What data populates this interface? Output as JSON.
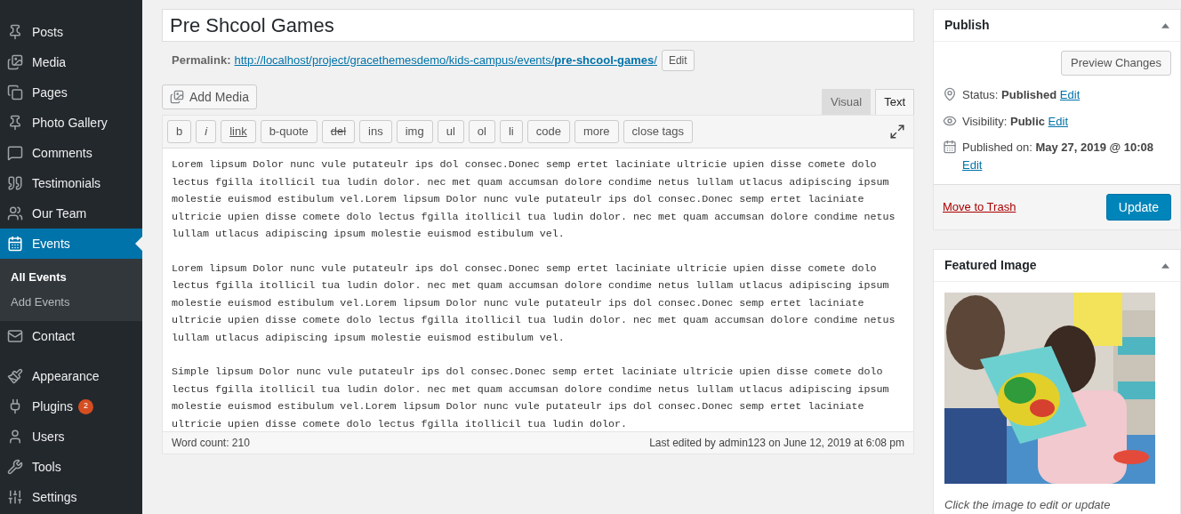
{
  "sidebar": {
    "sections": [
      {
        "items": [
          {
            "label": "Posts",
            "kind": "pin",
            "selected": false
          },
          {
            "label": "Media",
            "kind": "media",
            "selected": false
          },
          {
            "label": "Pages",
            "kind": "pages",
            "selected": false
          },
          {
            "label": "Photo Gallery",
            "kind": "pin",
            "selected": false
          },
          {
            "label": "Comments",
            "kind": "comment",
            "selected": false
          },
          {
            "label": "Testimonials",
            "kind": "quote",
            "selected": false
          },
          {
            "label": "Our Team",
            "kind": "team",
            "selected": false
          },
          {
            "label": "Events",
            "kind": "calendar",
            "selected": true,
            "children": [
              {
                "label": "All Events",
                "selected": true
              },
              {
                "label": "Add Events",
                "selected": false
              }
            ]
          },
          {
            "label": "Contact",
            "kind": "mail",
            "selected": false
          }
        ]
      },
      {
        "items": [
          {
            "label": "Appearance",
            "kind": "brush",
            "selected": false
          },
          {
            "label": "Plugins",
            "kind": "plug",
            "selected": false,
            "badge": "2"
          },
          {
            "label": "Users",
            "kind": "user",
            "selected": false
          },
          {
            "label": "Tools",
            "kind": "wrench",
            "selected": false
          },
          {
            "label": "Settings",
            "kind": "sliders",
            "selected": false
          }
        ]
      }
    ]
  },
  "editor": {
    "title": "Pre Shcool Games",
    "permalink": {
      "label": "Permalink:",
      "base": "http://localhost/project/gracethemesdemo/kids-campus/events/",
      "slug": "pre-shcool-games",
      "end": "/",
      "edit": "Edit"
    },
    "add_media": "Add Media",
    "tabs": [
      {
        "label": "Visual",
        "selected": false
      },
      {
        "label": "Text",
        "selected": true
      }
    ],
    "quicktags": [
      {
        "label": "b",
        "kind": "plain"
      },
      {
        "label": "i",
        "kind": "italic"
      },
      {
        "label": "link",
        "kind": "underline"
      },
      {
        "label": "b-quote",
        "kind": "plain"
      },
      {
        "label": "del",
        "kind": "strike"
      },
      {
        "label": "ins",
        "kind": "plain"
      },
      {
        "label": "img",
        "kind": "plain"
      },
      {
        "label": "ul",
        "kind": "plain"
      },
      {
        "label": "ol",
        "kind": "plain"
      },
      {
        "label": "li",
        "kind": "plain"
      },
      {
        "label": "code",
        "kind": "plain"
      },
      {
        "label": "more",
        "kind": "plain"
      },
      {
        "label": "close tags",
        "kind": "plain"
      }
    ],
    "paragraphs": [
      "Lorem lipsum Dolor nunc vule putateulr ips dol consec.Donec semp ertet laciniate ultricie upien disse comete dolo lectus fgilla itollicil tua ludin dolor. nec met quam accumsan dolore condime netus lullam utlacus adipiscing ipsum molestie euismod estibulum vel.Lorem lipsum Dolor nunc vule putateulr ips dol consec.Donec semp ertet laciniate ultricie upien disse comete dolo lectus fgilla itollicil tua ludin dolor. nec met quam accumsan dolore condime netus lullam utlacus adipiscing ipsum molestie euismod estibulum vel.",
      "Lorem lipsum Dolor nunc vule putateulr ips dol consec.Donec semp ertet laciniate ultricie upien disse comete dolo lectus fgilla itollicil tua ludin dolor. nec met quam accumsan dolore condime netus lullam utlacus adipiscing ipsum molestie euismod estibulum vel.Lorem lipsum Dolor nunc vule putateulr ips dol consec.Donec semp ertet laciniate ultricie upien disse comete dolo lectus fgilla itollicil tua ludin dolor. nec met quam accumsan dolore condime netus lullam utlacus adipiscing ipsum molestie euismod estibulum vel.",
      "Simple lipsum Dolor nunc vule putateulr ips dol consec.Donec semp ertet laciniate ultricie upien disse comete dolo lectus fgilla itollicil tua ludin dolor. nec met quam accumsan dolore condime netus lullam utlacus adipiscing ipsum molestie euismod estibulum vel.Lorem lipsum Dolor nunc vule putateulr ips dol consec.Donec semp ertet laciniate ultricie upien disse comete dolo lectus fgilla itollicil tua ludin dolor."
    ],
    "word_count": "Word count: 210",
    "last_edited": "Last edited by admin123 on June 12, 2019 at 6:08 pm"
  },
  "publish": {
    "title": "Publish",
    "preview": "Preview Changes",
    "rows": [
      {
        "kind": "pin",
        "label": "Status:",
        "value": "Published",
        "edit": "Edit"
      },
      {
        "kind": "eye",
        "label": "Visibility:",
        "value": "Public",
        "edit": "Edit"
      },
      {
        "kind": "calendar",
        "label": "Published on:",
        "value": "May 27, 2019 @ 10:08",
        "edit": "Edit"
      }
    ],
    "trash": "Move to Trash",
    "update": "Update"
  },
  "featured_image": {
    "title": "Featured Image",
    "caption": "Click the image to edit or update"
  }
}
